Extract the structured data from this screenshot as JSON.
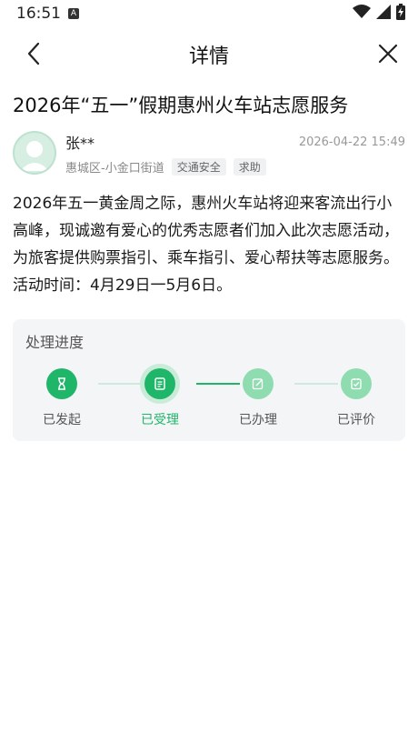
{
  "status_bar": {
    "time": "16:51",
    "notification_icon_text": "A",
    "icons": [
      "wifi-icon",
      "signal-icon",
      "battery-icon"
    ]
  },
  "nav": {
    "title": "详情",
    "back_icon": "chevron-left-icon",
    "close_icon": "close-icon"
  },
  "post": {
    "title": "2026年“五一”假期惠州火车站志愿服务",
    "author": "张**",
    "date": "2026-04-22 15:49",
    "location": "惠城区-小金口街道",
    "tags": [
      "交通安全",
      "求助"
    ],
    "content": "2026年五一黄金周之际，惠州火车站将迎来客流出行小高峰，现诚邀有爱心的优秀志愿者们加入此次志愿活动，为旅客提供购票指引、乘车指引、爱心帮扶等志愿服务。活动时间：4月29日一5月6日。"
  },
  "progress": {
    "title": "处理进度",
    "steps": [
      {
        "label": "已发起",
        "icon": "hourglass-icon",
        "state": "done"
      },
      {
        "label": "已受理",
        "icon": "document-icon",
        "state": "current"
      },
      {
        "label": "已办理",
        "icon": "edit-icon",
        "state": "pending"
      },
      {
        "label": "已评价",
        "icon": "check-square-icon",
        "state": "pending"
      }
    ]
  },
  "colors": {
    "accent": "#1fb66a",
    "pending": "#8fdcb1",
    "card_bg": "#f4f5f7"
  }
}
